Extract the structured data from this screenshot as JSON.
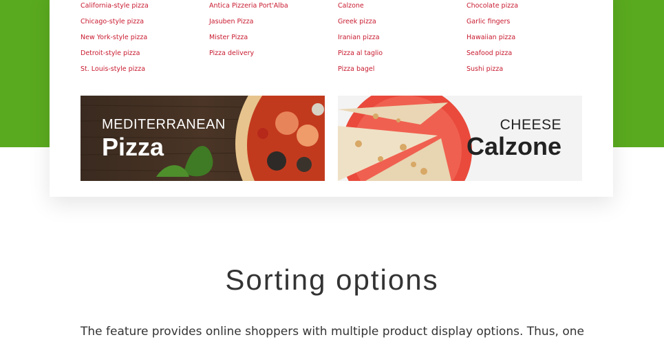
{
  "colors": {
    "accent_green": "#5aaa1f",
    "link_red": "#c8192e"
  },
  "pizza_links": {
    "col1": [
      "California-style pizza",
      "Chicago-style pizza",
      "New York-style pizza",
      "Detroit-style pizza",
      "St. Louis-style pizza"
    ],
    "col2": [
      "Antica Pizzeria Port'Alba",
      "Jasuben Pizza",
      "Mister Pizza",
      "Pizza delivery"
    ],
    "col3": [
      "Calzone",
      "Greek pizza",
      "Iranian pizza",
      "Pizza al taglio",
      "Pizza bagel"
    ],
    "col4": [
      "Chocolate pizza",
      "Garlic fingers",
      "Hawaiian pizza",
      "Seafood pizza",
      "Sushi pizza"
    ]
  },
  "banners": {
    "left": {
      "kicker": "MEDITERRANEAN",
      "title": "Pizza"
    },
    "right": {
      "kicker": "CHEESE",
      "title": "Calzone"
    }
  },
  "section": {
    "title": "Sorting options",
    "text": "The feature provides online shoppers with multiple product display options. Thus, one can opt for a"
  }
}
